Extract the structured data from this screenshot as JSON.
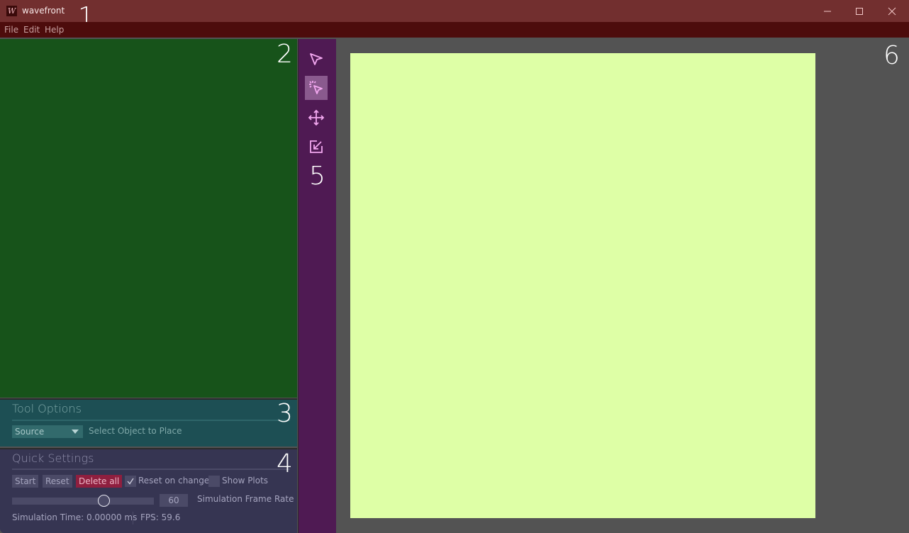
{
  "window": {
    "title": "wavefront",
    "icon_glyph": "W",
    "controls": [
      "minimize",
      "maximize",
      "close"
    ]
  },
  "menu": {
    "items": [
      "File",
      "Edit",
      "Help"
    ]
  },
  "annotations": [
    "1",
    "2",
    "3",
    "4",
    "5",
    "6"
  ],
  "tool_options": {
    "title": "Tool Options",
    "object_select": "Source",
    "hint": "Select Object to Place"
  },
  "quick_settings": {
    "title": "Quick Settings",
    "start_label": "Start",
    "reset_label": "Reset",
    "delete_all_label": "Delete all",
    "reset_on_change_label": "Reset on change",
    "reset_on_change_checked": true,
    "show_plots_label": "Show Plots",
    "show_plots_checked": false,
    "frame_rate_value": "60",
    "frame_rate_label": "Simulation Frame Rate",
    "simulation_time": "Simulation Time: 0.00000 ms",
    "fps": "FPS: 59.6"
  },
  "toolbar": {
    "tools": [
      {
        "name": "select-tool",
        "icon": "cursor-arrow-icon",
        "active": false
      },
      {
        "name": "place-tool",
        "icon": "cursor-click-icon",
        "active": true
      },
      {
        "name": "move-tool",
        "icon": "move-arrows-icon",
        "active": false
      },
      {
        "name": "resize-tool",
        "icon": "external-link-icon",
        "active": false
      }
    ]
  },
  "colors": {
    "titlebar": "#722f2f",
    "menubar": "#4d0c0c",
    "scene_panel": "#17531a",
    "tool_options_panel": "#1d4f54",
    "quick_settings_panel": "#363552",
    "toolbar": "#4f1a53",
    "canvas": "#deffa6",
    "danger": "#8f1f3f"
  }
}
